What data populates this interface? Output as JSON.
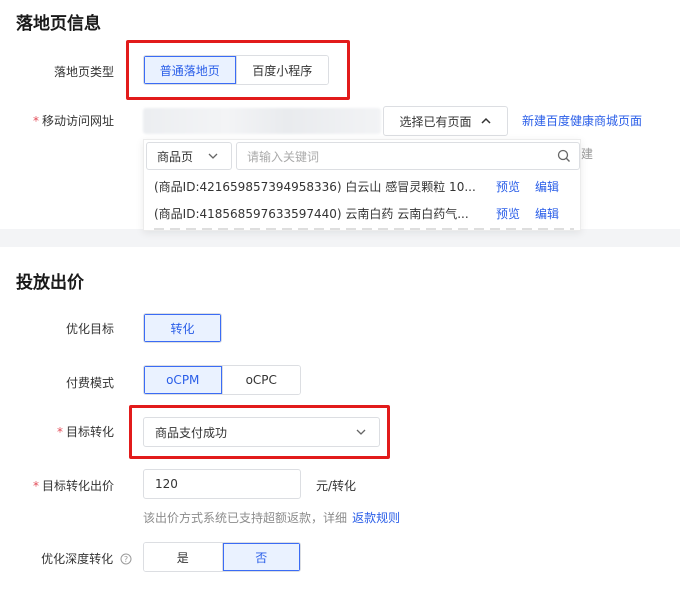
{
  "landing": {
    "title": "落地页信息",
    "page_type_label": "落地页类型",
    "page_type_options": [
      "普通落地页",
      "百度小程序"
    ],
    "mobile_url_label": "移动访问网址",
    "select_existing_label": "选择已有页面",
    "new_mall_link": "新建百度健康商城页面",
    "category_select": "商品页",
    "search_placeholder": "请输入关键词",
    "new_partial": "新建",
    "results": [
      {
        "text": "(商品ID:421659857394958336) 白云山 感冒灵颗粒 10...",
        "preview": "预览",
        "edit": "编辑"
      },
      {
        "text": "(商品ID:418568597633597440) 云南白药 云南白药气...",
        "preview": "预览",
        "edit": "编辑"
      }
    ]
  },
  "bidding": {
    "title": "投放出价",
    "goal_label": "优化目标",
    "goal_option": "转化",
    "pay_mode_label": "付费模式",
    "pay_mode_options": [
      "oCPM",
      "oCPC"
    ],
    "target_conv_label": "目标转化",
    "target_conv_value": "商品支付成功",
    "target_bid_label": "目标转化出价",
    "target_bid_value": "120",
    "target_bid_unit": "元/转化",
    "refund_note": "该出价方式系统已支持超额返款，详细",
    "refund_link": "返款规则",
    "deep_conv_label": "优化深度转化",
    "deep_conv_options": [
      "是",
      "否"
    ]
  },
  "colors": {
    "accent": "#2a5ee8",
    "highlight_box": "#e21b1b",
    "required": "#e34d59"
  }
}
